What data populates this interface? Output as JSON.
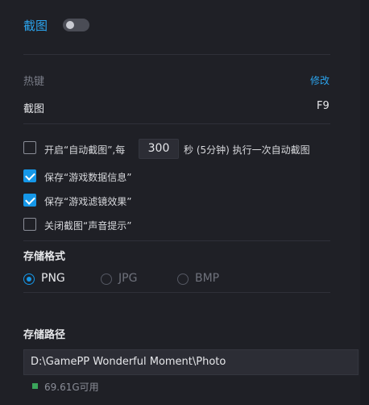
{
  "header": {
    "title": "截图",
    "toggle_on": false
  },
  "hotkey": {
    "section_label": "热键",
    "edit_label": "修改",
    "name": "截图",
    "key": "F9"
  },
  "options": {
    "auto_capture": {
      "checked": false,
      "prefix": "开启“自动截图”,每",
      "interval": "300",
      "suffix": "秒 (5分钟) 执行一次自动截图"
    },
    "save_game_info": {
      "checked": true,
      "label": "保存“游戏数据信息”"
    },
    "save_filter": {
      "checked": true,
      "label": "保存“游戏滤镜效果”"
    },
    "close_sound": {
      "checked": false,
      "label": "关闭截图“声音提示”"
    }
  },
  "format": {
    "title": "存储格式",
    "options": [
      {
        "label": "PNG",
        "selected": true
      },
      {
        "label": "JPG",
        "selected": false
      },
      {
        "label": "BMP",
        "selected": false
      }
    ]
  },
  "storage": {
    "title": "存储路径",
    "path": "D:\\GamePP Wonderful Moment\\Photo",
    "free": "69.61G可用"
  },
  "colors": {
    "accent": "#2ba3ec",
    "background": "#1f2026",
    "free_indicator": "#3aa55b"
  }
}
